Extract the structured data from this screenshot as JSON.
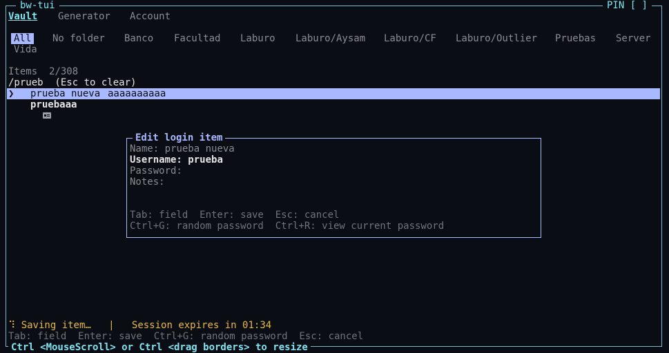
{
  "app": {
    "title": "bw-tui",
    "pin_label": "PIN [ ]"
  },
  "tabs": [
    {
      "label": "Vault",
      "active": true
    },
    {
      "label": "Generator",
      "active": false
    },
    {
      "label": "Account",
      "active": false
    }
  ],
  "folders": [
    "All",
    "No folder",
    "Banco",
    "Facultad",
    "Laburo",
    "Laburo/Aysam",
    "Laburo/CF",
    "Laburo/Outlier",
    "Pruebas",
    "Server",
    "Vida"
  ],
  "list": {
    "count_label": "Items",
    "count_value": "2/308",
    "filter_text": "/prueb  (Esc to clear)",
    "items": [
      {
        "cursor": "❯",
        "icon": "key-icon",
        "name": "prueba nueva",
        "subtitle": "aaaaaaaaaa",
        "selected": true
      },
      {
        "cursor": "",
        "icon": "id-card-icon",
        "name": "pruebaaa",
        "subtitle": "",
        "selected": false
      }
    ]
  },
  "modal": {
    "title": "Edit login item",
    "fields": [
      {
        "label": "Name:",
        "value": "prueba nueva",
        "focused": false
      },
      {
        "label": "Username:",
        "value": "prueba",
        "focused": true
      },
      {
        "label": "Password:",
        "value": "",
        "focused": false
      },
      {
        "label": "Notes:",
        "value": "",
        "focused": false
      }
    ],
    "help_line_1": "Tab: field  Enter: save  Esc: cancel",
    "help_line_2": "Ctrl+G: random password  Ctrl+R: view current password"
  },
  "status": {
    "spinner": "⠹",
    "message": "Saving item…",
    "separator": "|",
    "session": "Session expires in 01:34"
  },
  "footer_help": "Tab: field  Enter: save  Ctrl+G: random password  Esc: cancel",
  "bottom_bar": "Ctrl <MouseScroll> or Ctrl <drag borders> to resize"
}
